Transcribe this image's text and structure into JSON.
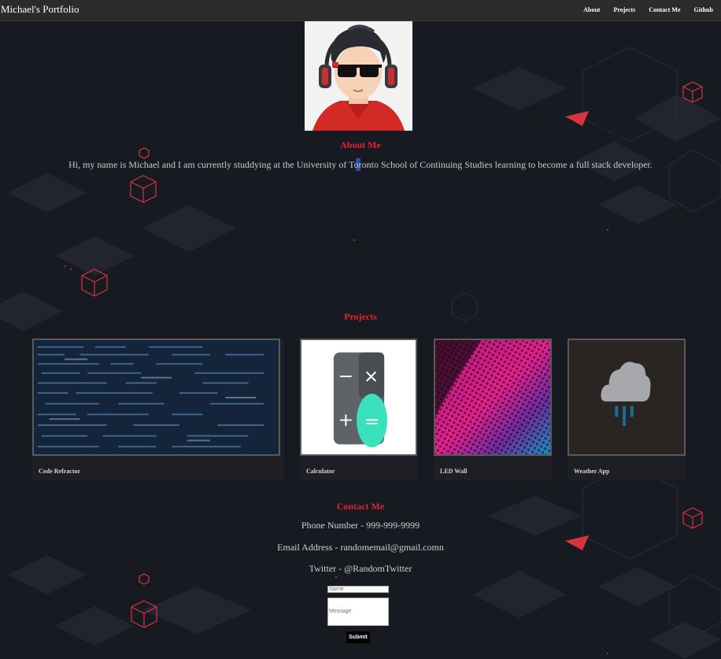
{
  "header": {
    "brand": "Michael's Portfolio",
    "nav": [
      "About",
      "Projects",
      "Contact Me",
      "Github"
    ]
  },
  "about": {
    "title": "About Me",
    "text": "Hi, my name is Michael and I am currently studdying at the University of Toronto School of Continuing Studies learning to become a full stack developer."
  },
  "projects": {
    "title": "Projects",
    "items": [
      {
        "name": "Code Refractor",
        "thumb_icon": "code-screenshot"
      },
      {
        "name": "Calculator",
        "thumb_icon": "calculator-icon"
      },
      {
        "name": "LED Wall",
        "thumb_icon": "led-dots-image"
      },
      {
        "name": "Weather App",
        "thumb_icon": "cloud-rain-icon"
      }
    ]
  },
  "contact": {
    "title": "Contact Me",
    "phone": "Phone Number - 999-999-9999",
    "email": "Email Address - randomemail@gmail.comn",
    "twitter": "Twitter - @RandomTwitter",
    "form": {
      "name_placeholder": "Name",
      "message_placeholder": "Message",
      "submit_label": "Submit"
    }
  },
  "colors": {
    "background": "#181a22",
    "accent": "#e5232f",
    "navbar": "#2b2b2b"
  }
}
